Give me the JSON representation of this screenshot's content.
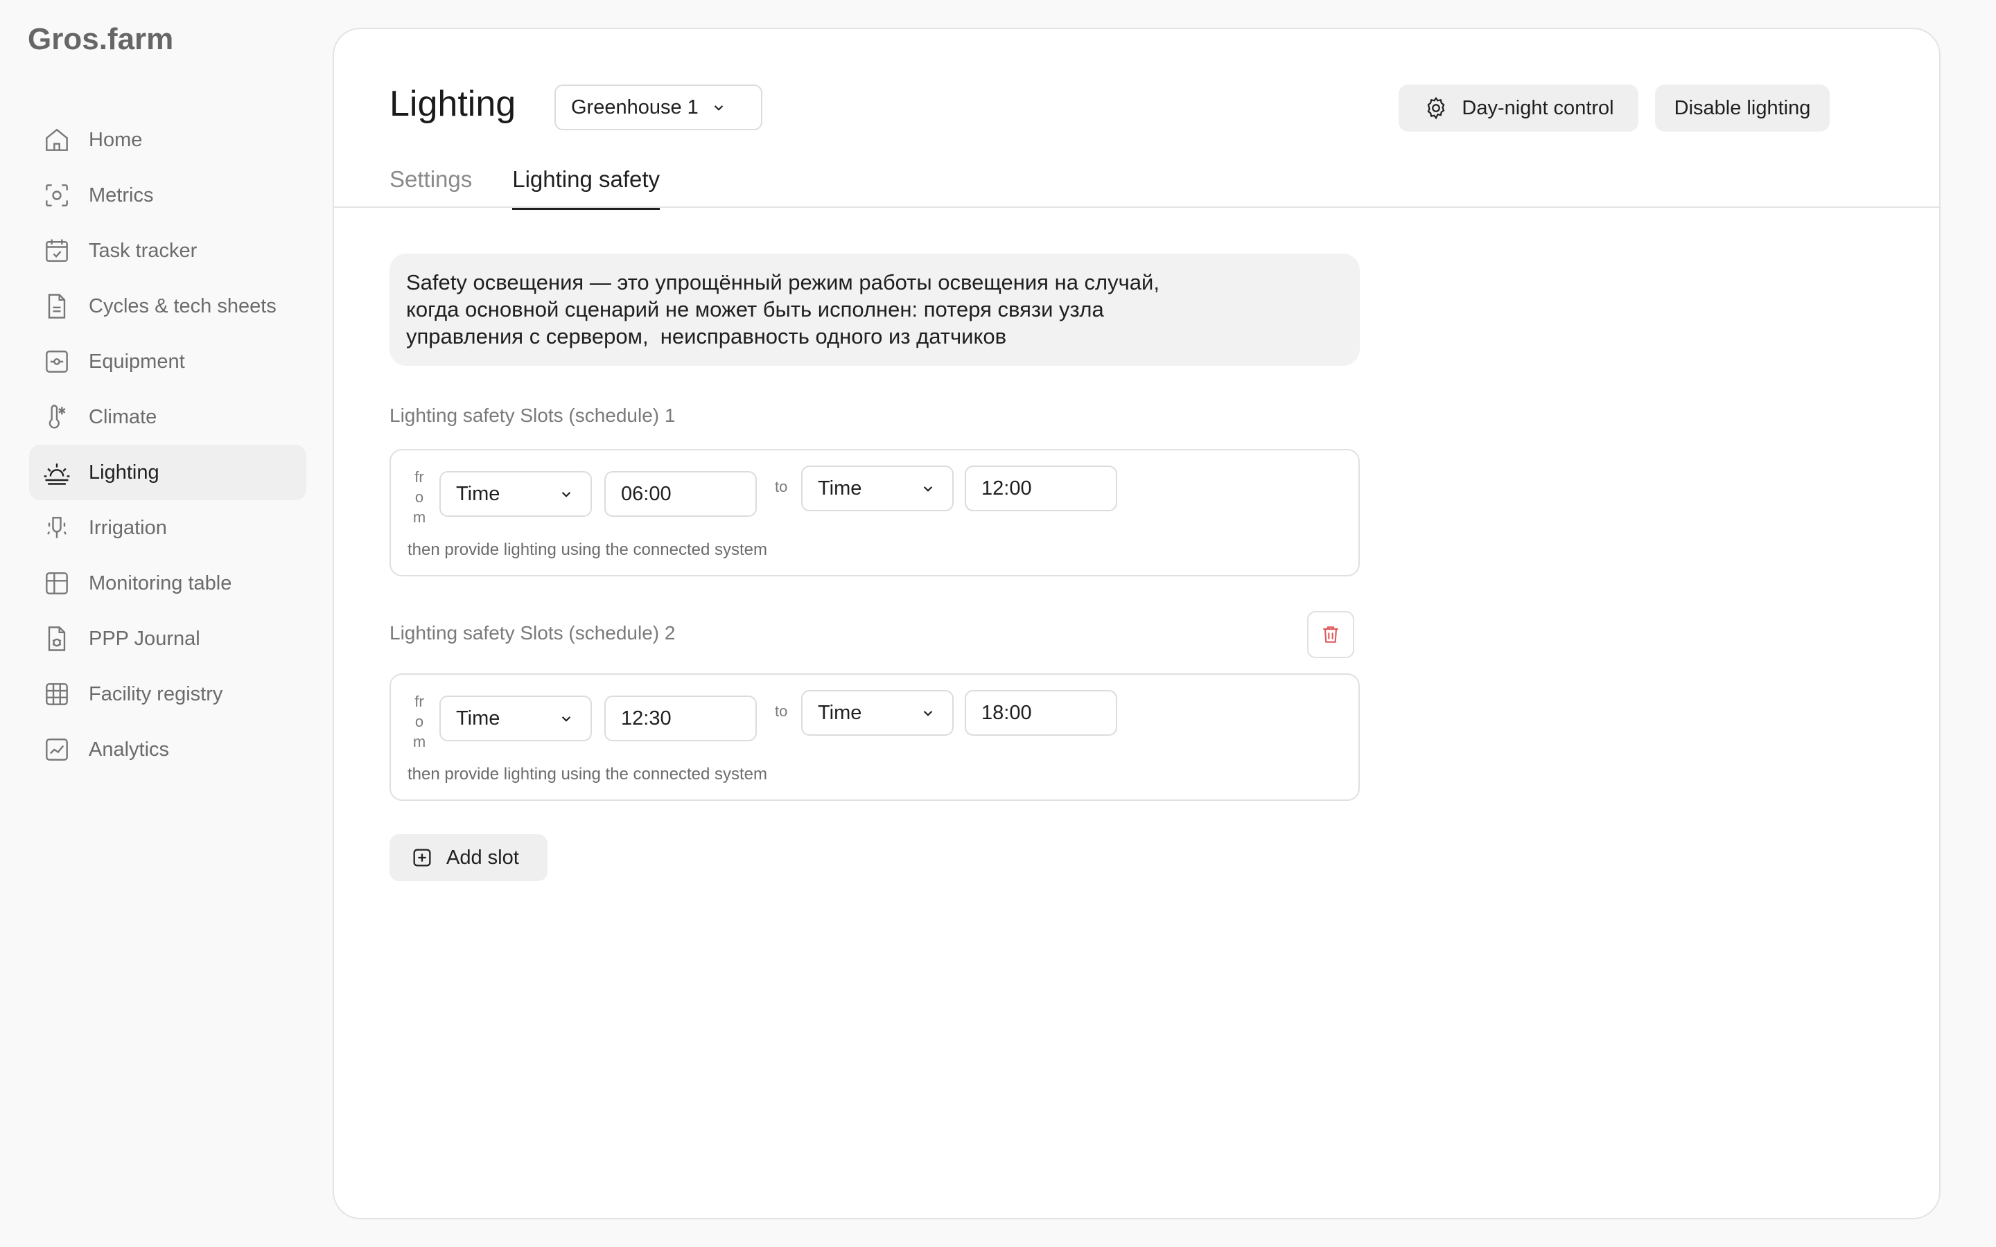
{
  "brand": {
    "logo": "Gros.farm"
  },
  "sidebar": {
    "items": [
      {
        "label": "Home",
        "icon": "home-icon"
      },
      {
        "label": "Metrics",
        "icon": "metrics-icon"
      },
      {
        "label": "Task tracker",
        "icon": "calendar-check-icon"
      },
      {
        "label": "Cycles & tech sheets",
        "icon": "document-icon"
      },
      {
        "label": "Equipment",
        "icon": "equipment-icon"
      },
      {
        "label": "Climate",
        "icon": "thermometer-icon"
      },
      {
        "label": "Lighting",
        "icon": "sunrise-icon",
        "active": true
      },
      {
        "label": "Irrigation",
        "icon": "irrigation-icon"
      },
      {
        "label": "Monitoring table",
        "icon": "table-icon"
      },
      {
        "label": "PPP Journal",
        "icon": "bug-document-icon"
      },
      {
        "label": "Facility registry",
        "icon": "grid-icon"
      },
      {
        "label": "Analytics",
        "icon": "chart-icon"
      }
    ]
  },
  "header": {
    "title": "Lighting",
    "greenhouse_select": "Greenhouse 1",
    "day_night_button": "Day-night control",
    "disable_button": "Disable lighting"
  },
  "tabs": [
    {
      "label": "Settings",
      "active": false
    },
    {
      "label": "Lighting safety",
      "active": true
    }
  ],
  "info": {
    "lines": [
      "Safety освещения — это упрощённый режим работы освещения на случай,",
      "когда основной сценарий не может быть исполнен: потеря связи узла",
      "управления с сервером,  неисправность одного из датчиков"
    ]
  },
  "slots": [
    {
      "title": "Lighting safety Slots (schedule) 1",
      "from_letters": [
        "fr",
        "o",
        "m"
      ],
      "from_type": "Time",
      "from_value": "06:00",
      "to_label": "to",
      "to_type": "Time",
      "to_value": "12:00",
      "note": "then provide lighting using the connected system"
    },
    {
      "title": "Lighting safety Slots (schedule) 2",
      "from_letters": [
        "fr",
        "o",
        "m"
      ],
      "from_type": "Time",
      "from_value": "12:30",
      "to_label": "to",
      "to_type": "Time",
      "to_value": "18:00",
      "note": "then provide lighting using the connected system"
    }
  ],
  "add_slot_label": "Add slot",
  "colors": {
    "accent": "#1f1f1f",
    "muted": "#7a7a7a",
    "delete": "#e05a5a",
    "chip": "#efefef"
  }
}
